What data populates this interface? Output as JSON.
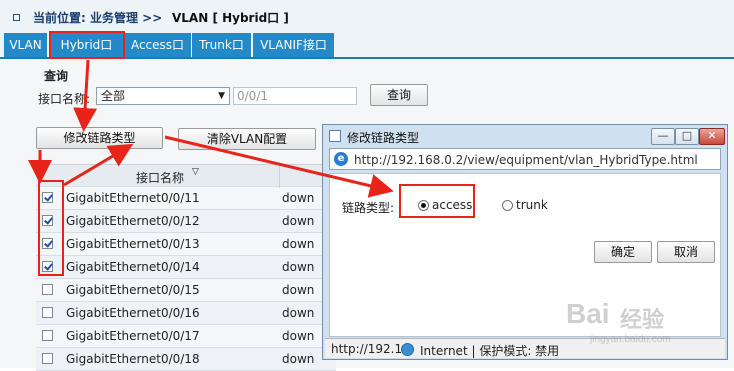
{
  "breadcrumb": {
    "prefix": "当前位置: 业务管理 >>",
    "current": "VLAN [ Hybrid口 ]"
  },
  "tabs": [
    {
      "label": "VLAN"
    },
    {
      "label": "Hybrid口"
    },
    {
      "label": "Access口"
    },
    {
      "label": "Trunk口"
    },
    {
      "label": "VLANIF接口"
    }
  ],
  "query": {
    "title": "查询",
    "port_label": "接口名称:",
    "port_select": "全部",
    "port_input_placeholder": "0/0/1",
    "query_button": "查询"
  },
  "actions": {
    "modify_link_type": "修改链路类型",
    "clear_vlan": "清除VLAN配置"
  },
  "table": {
    "header_name": "接口名称",
    "rows": [
      {
        "name": "GigabitEthernet0/0/11",
        "status": "down",
        "checked": true
      },
      {
        "name": "GigabitEthernet0/0/12",
        "status": "down",
        "checked": true
      },
      {
        "name": "GigabitEthernet0/0/13",
        "status": "down",
        "checked": true
      },
      {
        "name": "GigabitEthernet0/0/14",
        "status": "down",
        "checked": true
      },
      {
        "name": "GigabitEthernet0/0/15",
        "status": "down",
        "checked": false
      },
      {
        "name": "GigabitEthernet0/0/16",
        "status": "down",
        "checked": false
      },
      {
        "name": "GigabitEthernet0/0/17",
        "status": "down",
        "checked": false
      },
      {
        "name": "GigabitEthernet0/0/18",
        "status": "down",
        "checked": false
      }
    ]
  },
  "dialog": {
    "title": "修改链路类型",
    "url": "http://192.168.0.2/view/equipment/vlan_HybridType.html",
    "link_type_label": "链路类型:",
    "option_access": "access",
    "option_trunk": "trunk",
    "selected": "access",
    "ok": "确定",
    "cancel": "取消",
    "status_url": "http://192.1",
    "status_zone": "Internet | 保护模式: 禁用"
  },
  "watermark": {
    "brand": "Bai",
    "brand2": "经验",
    "url": "jingyan.baidu.com"
  },
  "colors": {
    "tab_bg": "#2389c7",
    "highlight": "#e8241a",
    "arrow": "#e8241a"
  }
}
